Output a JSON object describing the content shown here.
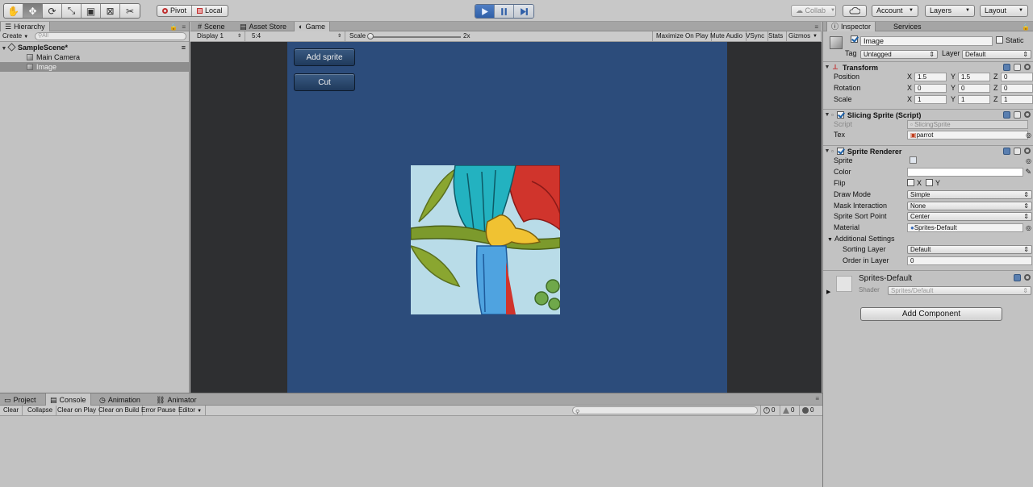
{
  "toolbar": {
    "tools": [
      "hand-tool-icon",
      "move-tool-icon",
      "rotate-tool-icon",
      "scale-tool-icon",
      "rect-tool-icon",
      "transform-tool-icon",
      "custom-tool-icon"
    ],
    "active_tool": "move-tool-icon",
    "pivot_label": "Pivot",
    "local_label": "Local",
    "collab_label": "Collab",
    "account_label": "Account",
    "layers_label": "Layers",
    "layout_label": "Layout",
    "play_active_color": "#3a6cb8"
  },
  "hierarchy": {
    "tab_label": "Hierarchy",
    "create_label": "Create",
    "search_placeholder": "All",
    "scene_name": "SampleScene*",
    "items": [
      {
        "label": "Main Camera",
        "selected": false
      },
      {
        "label": "Image",
        "selected": true
      }
    ]
  },
  "game": {
    "tabs": [
      {
        "label": "Scene",
        "icon": "scene-icon"
      },
      {
        "label": "Asset Store",
        "icon": "asset-store-icon"
      },
      {
        "label": "Game",
        "icon": "game-icon"
      }
    ],
    "active_tab": "Game",
    "display_label": "Display 1",
    "aspect_label": "5:4",
    "scale_label": "Scale",
    "scale_value": "2x",
    "scale_fraction": 0.0,
    "maximize_label": "Maximize On Play",
    "mute_label": "Mute Audio",
    "vsync_label": "VSync",
    "stats_label": "Stats",
    "gizmos_label": "Gizmos",
    "buttons": {
      "add_sprite": "Add sprite",
      "cut": "Cut"
    },
    "background_color": "#2c4c7b"
  },
  "inspector": {
    "tabs": [
      "Inspector",
      "Services"
    ],
    "object_name": "Image",
    "static_label": "Static",
    "tag_label": "Tag",
    "tag_value": "Untagged",
    "layer_label": "Layer",
    "layer_value": "Default",
    "transform": {
      "title": "Transform",
      "rows": [
        {
          "label": "Position",
          "x": "1.5",
          "y": "1.5",
          "z": "0"
        },
        {
          "label": "Rotation",
          "x": "0",
          "y": "0",
          "z": "0"
        },
        {
          "label": "Scale",
          "x": "1",
          "y": "1",
          "z": "1"
        }
      ],
      "axis_x": "X",
      "axis_y": "Y",
      "axis_z": "Z"
    },
    "slicing": {
      "title": "Slicing Sprite (Script)",
      "script_label": "Script",
      "script_value": "SlicingSprite",
      "tex_label": "Tex",
      "tex_value": "parrot"
    },
    "renderer": {
      "title": "Sprite Renderer",
      "sprite_label": "Sprite",
      "color_label": "Color",
      "flip_label": "Flip",
      "flip_x": "X",
      "flip_y": "Y",
      "draw_mode_label": "Draw Mode",
      "draw_mode_value": "Simple",
      "mask_label": "Mask Interaction",
      "mask_value": "None",
      "sort_point_label": "Sprite Sort Point",
      "sort_point_value": "Center",
      "material_label": "Material",
      "material_value": "Sprites-Default",
      "additional_label": "Additional Settings",
      "sorting_layer_label": "Sorting Layer",
      "sorting_layer_value": "Default",
      "order_label": "Order in Layer",
      "order_value": "0"
    },
    "material": {
      "name": "Sprites-Default",
      "shader_label": "Shader",
      "shader_value": "Sprites/Default"
    },
    "add_component_label": "Add Component"
  },
  "bottom": {
    "tabs": [
      {
        "label": "Project",
        "icon": "project-icon"
      },
      {
        "label": "Console",
        "icon": "console-icon"
      },
      {
        "label": "Animation",
        "icon": "animation-icon"
      },
      {
        "label": "Animator",
        "icon": "animator-icon"
      }
    ],
    "active_tab": "Console",
    "buttons": [
      "Clear",
      "Collapse",
      "Clear on Play",
      "Clear on Build",
      "Error Pause",
      "Editor"
    ],
    "info_count": "0",
    "warn_count": "0",
    "error_count": "0"
  }
}
